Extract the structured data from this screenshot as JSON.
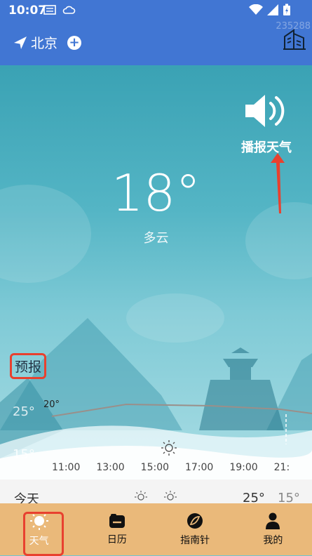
{
  "status_bar": {
    "time": "10:07"
  },
  "header": {
    "city": "北京",
    "add_symbol": "+",
    "faint_id": "235288"
  },
  "weather": {
    "temperature": "18°",
    "condition": "多云",
    "broadcast_label": "播报天气"
  },
  "forecast": {
    "label": "预报",
    "y_high": "25°",
    "y_low": "15°",
    "point_label": "20°",
    "hours": [
      "11:00",
      "13:00",
      "15:00",
      "17:00",
      "19:00",
      "21:"
    ]
  },
  "today": {
    "label": "今天",
    "high": "25°",
    "low": "15°"
  },
  "tabs": [
    {
      "label": "天气",
      "icon": "sun-icon",
      "active": true
    },
    {
      "label": "日历",
      "icon": "calendar-icon",
      "active": false
    },
    {
      "label": "指南针",
      "icon": "compass-icon",
      "active": false
    },
    {
      "label": "我的",
      "icon": "person-icon",
      "active": false
    }
  ],
  "colors": {
    "header_bg": "#4176d3",
    "tabbar_bg": "#eab97a",
    "annotation_red": "#e8412f"
  }
}
